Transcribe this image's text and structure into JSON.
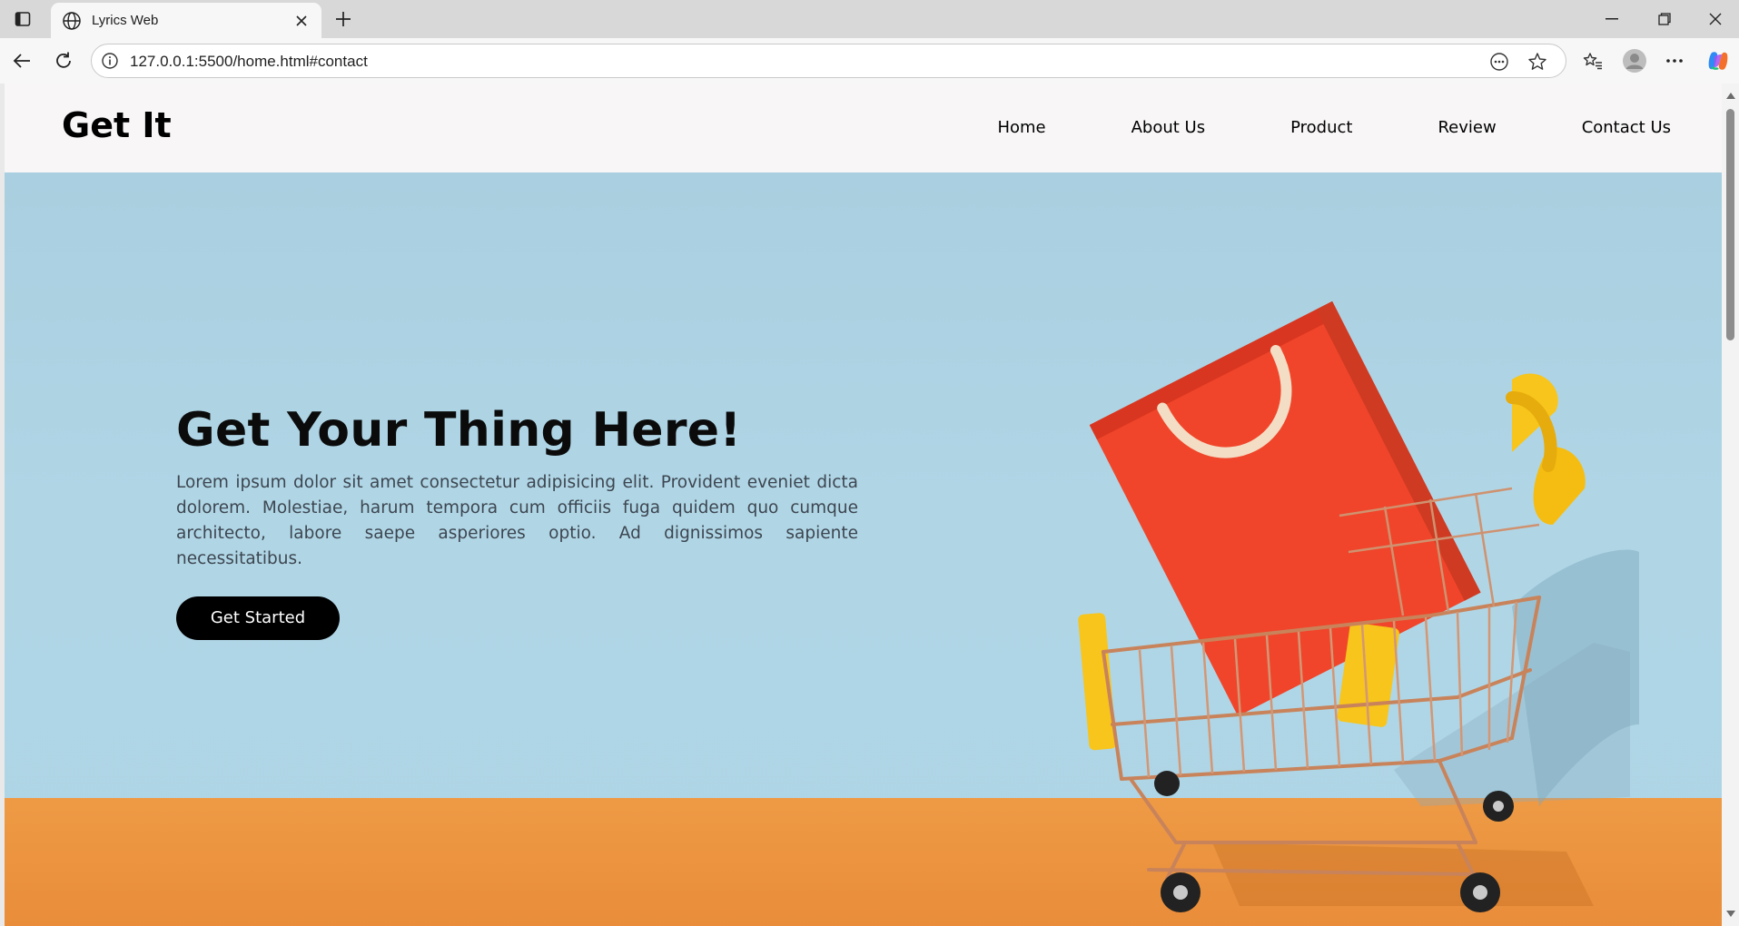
{
  "browser": {
    "tab_title": "Lyrics Web",
    "url": "127.0.0.1:5500/home.html#contact"
  },
  "site": {
    "logo": "Get It",
    "nav": [
      "Home",
      "About Us",
      "Product",
      "Review",
      "Contact Us"
    ]
  },
  "hero": {
    "headline": "Get Your Thing Here!",
    "body": "Lorem ipsum dolor sit amet consectetur adipisicing elit. Provident eveniet dicta dolorem. Molestiae, harum tempora cum officiis fuga quidem quo cumque architecto, labore saepe asperiores optio. Ad dignissimos sapiente necessitatibus.",
    "cta_label": "Get Started"
  },
  "colors": {
    "sky": "#aed4e5",
    "floor": "#eb923f",
    "bag": "#f0452a",
    "cart_accent": "#f7c51b",
    "button_bg": "#000000"
  }
}
